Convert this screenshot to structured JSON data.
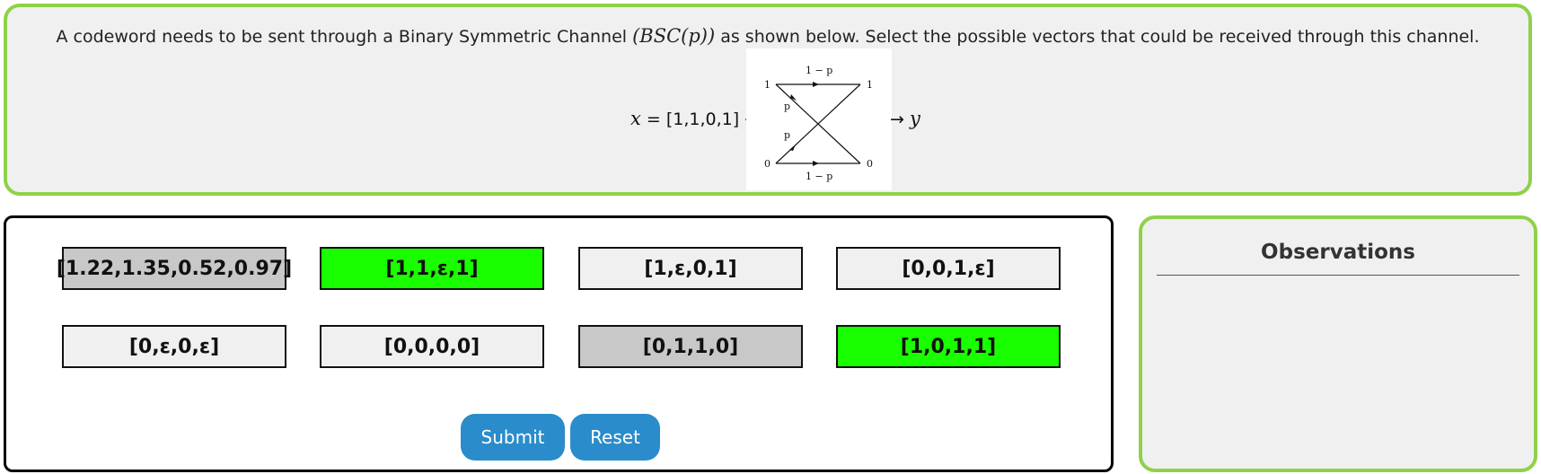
{
  "question": {
    "text_before": "A codeword needs to be sent through a Binary Symmetric Channel ",
    "math_channel": "(BSC(p))",
    "text_after": " as shown below. Select the possible vectors that could be received through this channel.",
    "formula_left_var": "x",
    "formula_left_rest": " = [1,1,0,1] →",
    "formula_right_arrow": "→ ",
    "formula_right_var": "y"
  },
  "diagram": {
    "top_left": "1",
    "top_right": "1",
    "bottom_left": "0",
    "bottom_right": "0",
    "top_edge_label": "1 − p",
    "bottom_edge_label": "1 − p",
    "cross_label_upper": "p",
    "cross_label_lower": "p"
  },
  "options": [
    {
      "label": "[1.22,1.35,0.52,0.97]",
      "bg": "#c8c8c8"
    },
    {
      "label": "[1,1,ε,1]",
      "bg": "#19ff00"
    },
    {
      "label": "[1,ε,0,1]",
      "bg": "#f0f0f0"
    },
    {
      "label": "[0,0,1,ε]",
      "bg": "#f0f0f0"
    },
    {
      "label": "[0,ε,0,ε]",
      "bg": "#f0f0f0"
    },
    {
      "label": "[0,0,0,0]",
      "bg": "#f0f0f0"
    },
    {
      "label": "[0,1,1,0]",
      "bg": "#c8c8c8"
    },
    {
      "label": "[1,0,1,1]",
      "bg": "#19ff00"
    }
  ],
  "buttons": {
    "submit": "Submit",
    "reset": "Reset"
  },
  "observations": {
    "title": "Observations"
  }
}
